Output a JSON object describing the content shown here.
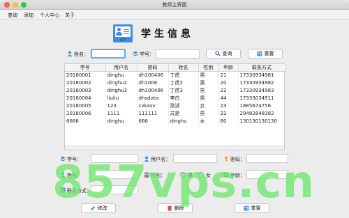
{
  "window": {
    "title": "教师主界面"
  },
  "menu": [
    "查询",
    "添加",
    "个人中心",
    "关于"
  ],
  "page": {
    "title": "学生信息"
  },
  "search": {
    "name_label": "姓名：",
    "name_value": "",
    "id_label": "学号：",
    "id_value": "",
    "query_label": "查询",
    "reset_label": "重置"
  },
  "table": {
    "columns": [
      "学号",
      "用户名",
      "密码",
      "姓名",
      "性别",
      "年龄",
      "联系方式"
    ],
    "rows": [
      [
        "20180001",
        "dinghu",
        "dh100406",
        "丁虎",
        "男",
        "21",
        "17330934981"
      ],
      [
        "20180002",
        "dinghu2",
        "dh1006",
        "丁虎2",
        "男",
        "20",
        "17330934982"
      ],
      [
        "20180003",
        "dinghu3",
        "dh100406",
        "丁虎3",
        "男",
        "22",
        "17330934983"
      ],
      [
        "20180004",
        "liuliu",
        "dhsdvbs",
        "李白",
        "男",
        "44",
        "17333034911"
      ],
      [
        "20180005",
        "123",
        "cvkasv",
        "测试",
        "女",
        "23",
        "1885674756"
      ],
      [
        "20180006",
        "1111",
        "111111",
        "苏是",
        "男",
        "22",
        "29482848382"
      ],
      [
        "6666",
        "dinghu",
        "666",
        "dinghu",
        "女",
        "80",
        "130130130130"
      ]
    ]
  },
  "form": {
    "id_label": "学号：",
    "username_label": "用户名：",
    "password_label": "密码：",
    "name_label": "姓名：",
    "gender_label": "性别：",
    "male_label": "男",
    "female_label": "女",
    "age_label": "年龄：",
    "contact_label": "联系方式："
  },
  "actions": {
    "edit_label": "修改",
    "delete_label": "删除",
    "reset_label": "重置"
  },
  "watermark": "857vps.cn",
  "colors": {
    "accent": "#3a8ee6",
    "focus": "#6aa5f0",
    "watermark": "#6ee66e"
  }
}
